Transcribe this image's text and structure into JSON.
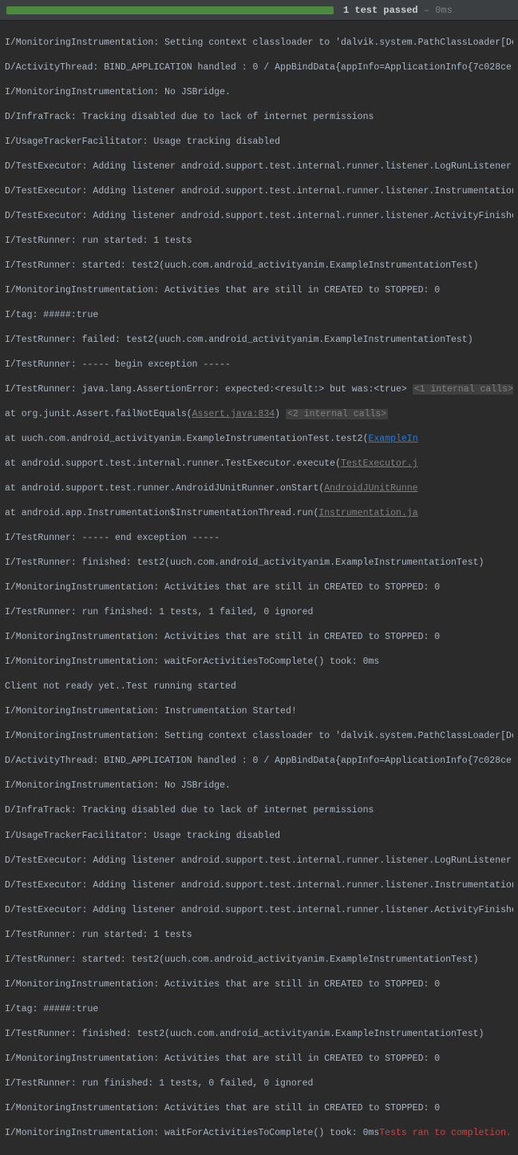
{
  "status": {
    "passed_text": "1 test passed",
    "time_text": " – 0ms"
  },
  "hints": {
    "internal_calls_1": "<1 internal calls>",
    "internal_calls_2": "<2 internal calls>"
  },
  "links": {
    "assert_java": "Assert.java:834",
    "example_in": "ExampleIn",
    "test_executor": "TestExecutor.j",
    "android_junit": "AndroidJUnitRunne",
    "instrumentation": "Instrumentation.ja"
  },
  "result": {
    "completion": "Tests ran to completion."
  },
  "lines": {
    "l0": "I/MonitoringInstrumentation: Setting context classloader to 'dalvik.system.PathClassLoader[De",
    "l1": "D/ActivityThread: BIND_APPLICATION handled : 0 / AppBindData{appInfo=ApplicationInfo{7c028ce ",
    "l2": "I/MonitoringInstrumentation: No JSBridge.",
    "l3": "D/InfraTrack: Tracking disabled due to lack of internet permissions",
    "l4": "I/UsageTrackerFacilitator: Usage tracking disabled",
    "l5": "D/TestExecutor: Adding listener android.support.test.internal.runner.listener.LogRunListener ",
    "l6": "D/TestExecutor: Adding listener android.support.test.internal.runner.listener.Instrumentation",
    "l7": "D/TestExecutor: Adding listener android.support.test.internal.runner.listener.ActivityFinishe",
    "l8": "I/TestRunner: run started: 1 tests",
    "l9": "I/TestRunner: started: test2(uuch.com.android_activityanim.ExampleInstrumentationTest)",
    "l10": "I/MonitoringInstrumentation: Activities that are still in CREATED to STOPPED: 0",
    "l11": "I/tag: #####:true",
    "l12": "I/TestRunner: failed: test2(uuch.com.android_activityanim.ExampleInstrumentationTest)",
    "l13": "I/TestRunner: ----- begin exception -----",
    "l14a": "I/TestRunner: java.lang.AssertionError: expected:<result:> but was:<true> ",
    "l15a": "                  at org.junit.Assert.failNotEquals(",
    "l15b": ") ",
    "l16a": "                  at uuch.com.android_activityanim.ExampleInstrumentationTest.test2(",
    "l17a": "                  at android.support.test.internal.runner.TestExecutor.execute(",
    "l18a": "                  at android.support.test.runner.AndroidJUnitRunner.onStart(",
    "l19a": "                  at android.app.Instrumentation$InstrumentationThread.run(",
    "l20": "I/TestRunner: ----- end exception -----",
    "l21": "I/TestRunner: finished: test2(uuch.com.android_activityanim.ExampleInstrumentationTest)",
    "l22": "I/MonitoringInstrumentation: Activities that are still in CREATED to STOPPED: 0",
    "l23": "I/TestRunner: run finished: 1 tests, 1 failed, 0 ignored",
    "l24": "I/MonitoringInstrumentation: Activities that are still in CREATED to STOPPED: 0",
    "l25": "I/MonitoringInstrumentation: waitForActivitiesToComplete() took: 0ms",
    "l26": "Client not ready yet..Test running started",
    "l27": "I/MonitoringInstrumentation: Instrumentation Started!",
    "l28": "I/MonitoringInstrumentation: Setting context classloader to 'dalvik.system.PathClassLoader[De",
    "l29": "D/ActivityThread: BIND_APPLICATION handled : 0 / AppBindData{appInfo=ApplicationInfo{7c028ce ",
    "l30": "I/MonitoringInstrumentation: No JSBridge.",
    "l31": "D/InfraTrack: Tracking disabled due to lack of internet permissions",
    "l32": "I/UsageTrackerFacilitator: Usage tracking disabled",
    "l33": "D/TestExecutor: Adding listener android.support.test.internal.runner.listener.LogRunListener ",
    "l34": "D/TestExecutor: Adding listener android.support.test.internal.runner.listener.Instrumentation",
    "l35": "D/TestExecutor: Adding listener android.support.test.internal.runner.listener.ActivityFinishe",
    "l36": "I/TestRunner: run started: 1 tests",
    "l37": "I/TestRunner: started: test2(uuch.com.android_activityanim.ExampleInstrumentationTest)",
    "l38": "I/MonitoringInstrumentation: Activities that are still in CREATED to STOPPED: 0",
    "l39": "I/tag: #####:true",
    "l40": "I/TestRunner: finished: test2(uuch.com.android_activityanim.ExampleInstrumentationTest)",
    "l41": "I/MonitoringInstrumentation: Activities that are still in CREATED to STOPPED: 0",
    "l42": "I/TestRunner: run finished: 1 tests, 0 failed, 0 ignored",
    "l43": "I/MonitoringInstrumentation: Activities that are still in CREATED to STOPPED: 0",
    "l44a": "I/MonitoringInstrumentation: waitForActivitiesToComplete() took: 0ms"
  }
}
